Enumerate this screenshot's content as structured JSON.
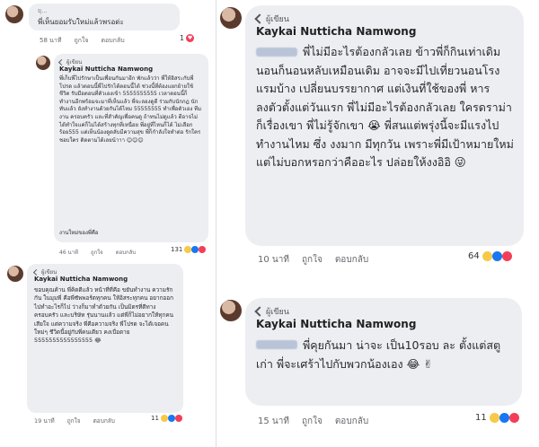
{
  "top_left": {
    "user_blur": "ยุ...",
    "text": "พี่เห็นยอมรับใหม่แล้วพรอด่ะ",
    "time": "58 นาที",
    "like": "ถูกใจ",
    "reply": "ตอบกลับ",
    "count": "1"
  },
  "left_comment_1": {
    "badge": "ผู้เขียน",
    "name": "Kaykai Nutticha Namwong",
    "text": "พี่เก็บพี่ไปรักษาเป็นเพื่อนกันมาอีก พักแล้วว่า พี่ให้อิสระกับพี่โปรด แล้วตอนนี้พี่ไปรักได้ตอนนี้ได้ ช่วงนี้ที่ต้องแยกย้ายใช้ชีวิต รับมือตอนที่ตัวเองเข้า 5555555555 เวลาตอนนี้ก็ทำงานอีกพร้อมจะมาที่เห็นแล้ว พี่จะลองดูดี ร่วมกับนักกฎ นักทับแล้ว ยังทำงานด้วยกันได้ไหม 55555555 ทำเพื่อตัวเอง ทีมงาน ครอบครัว และที่สำคัญเพื่อคนดู ถ้าทนไม่ดูแล้ว ตีอาจไม่ได้ทำใจแค่ก็ไม่ได้สร้างทุกที่เหนื่อย พี่อยู่ที่ไหนก็ได้ ไม่เลือกร้อย555 แต่เห็นน้องดูดลับมีความสุข พี่ก็กำลังใจทำต่อ รักใครชอบใคร ติดตามได้เลยน้าาา 😊😊😊",
    "text2": "งานใหม่ของพี่คือ",
    "time": "46 นาที",
    "like": "ถูกใจ",
    "reply": "ตอบกลับ",
    "count": "131"
  },
  "left_comment_2": {
    "badge": "ผู้เขียน",
    "name": "Kaykai Nutticha Namwong",
    "text": "ขอบคุณค้าน พี่คิดดีแล้ว หน้าที่ที่คือ ขยันทำงาน ความรักกัน ในมุมพี่ คือพี่ซัพพอร์ตทุกคน ให้อิสระทุกคน อยากออกไปทำอะไรก็ไป ว่างก็มาทำด้วยกัน เป็นมิตรที่ดีทางครอบครัว และบริษัท รุ่นนานแล้ว แต่พี่ก็ไม่อยากให้ทุกคนเสียใจ แต่ความจริง พี่คือความจริง พี่โปรด จะได้เจอคนใหม่ๆ ชีวิตนี้อยู่กับพี่คนเดียว คงเบื่อตาย 5555555555555555 😂",
    "time": "19 นาที",
    "like": "ถูกใจ",
    "reply": "ตอบกลับ",
    "count": "11"
  },
  "right_comment_1": {
    "badge": "ผู้เขียน",
    "name": "Kaykai Nutticha Namwong",
    "text": "พี่ไม่มีอะไรต้องกลัวเลย ข้าวพี่ก็กินเท่าเดิม นอนก็นอนหลับเหมือนเดิม อาจจะมีไปเที่ยวนอนโรงแรมบ้าง เปลี่ยนบรรยากาศ แต่เงินที่ใช้ของพี่ หารลงตัวตั้งแต่วันแรก พี่ไม่มีอะไรต้องกลัวเลย ใครดราม่า ก็เรื่องเขา พี่ไม่รู้จักเขา 😭 พี่สนแต่พรุ่งนี้จะมีแรงไปทำงานไหม ซึ่ง งงมาก มีทุกวัน เพราะพี่มีเป้าหมายใหม่ แต่ไม่บอกหรอกว่าคืออะไร ปล่อยให้งงอิอิ 😜",
    "time": "10 นาที",
    "like": "ถูกใจ",
    "reply": "ตอบกลับ",
    "count": "64"
  },
  "right_comment_2": {
    "badge": "ผู้เขียน",
    "name": "Kaykai Nutticha Namwong",
    "text": "พี่คุยกันมา น่าจะ เป็น10รอบ ละ ตั้งแต่สตูเก่า พี่จะเศร้าไปกับพวกน้องเอง 😂 ✌",
    "time": "15 นาที",
    "like": "ถูกใจ",
    "reply": "ตอบกลับ",
    "count": "11"
  }
}
